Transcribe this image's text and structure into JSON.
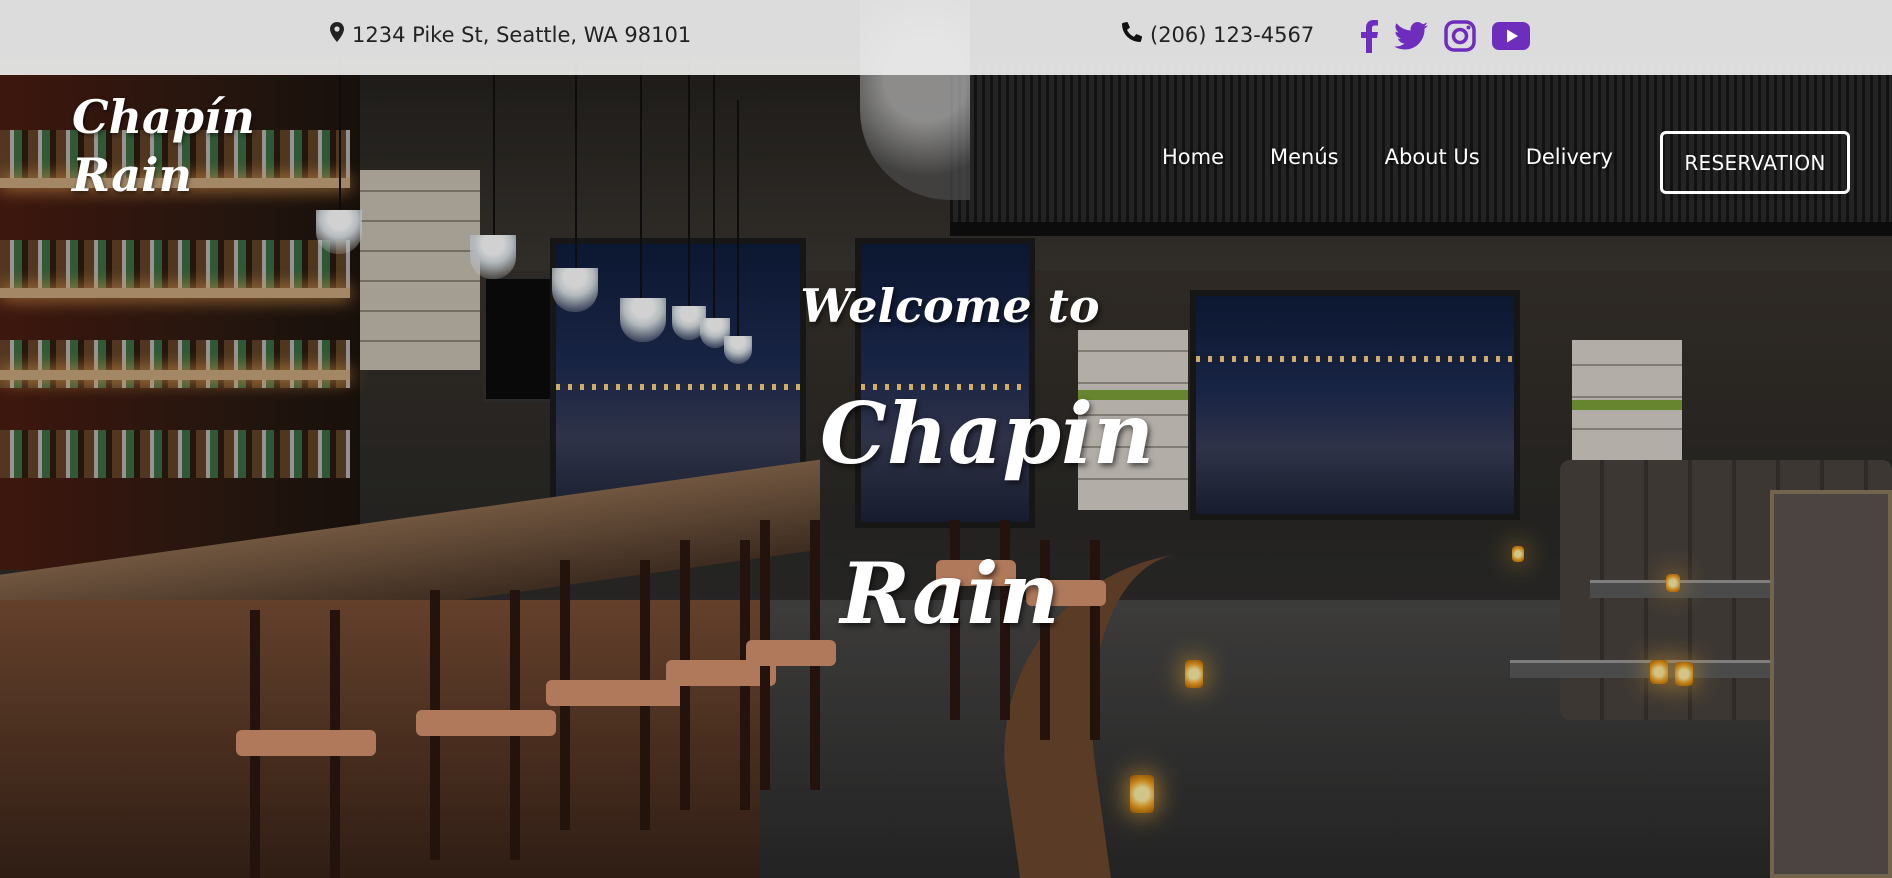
{
  "topbar": {
    "address": "1234 Pike St, Seattle, WA 98101",
    "address_icon": "map-marker-icon",
    "phone": "(206) 123-4567",
    "phone_icon": "phone-icon",
    "social": [
      {
        "name": "facebook-icon",
        "color": "#6f2dbd"
      },
      {
        "name": "twitter-icon",
        "color": "#6f2dbd"
      },
      {
        "name": "instagram-icon",
        "color": "#6f2dbd"
      },
      {
        "name": "youtube-icon",
        "color": "#6f2dbd"
      }
    ]
  },
  "logo": {
    "text": "Chapín Rain"
  },
  "nav": {
    "items": [
      {
        "label": "Home"
      },
      {
        "label": "Menús"
      },
      {
        "label": "About Us"
      },
      {
        "label": "Delivery"
      }
    ],
    "reservation_label": "RESERVATION"
  },
  "hero": {
    "welcome": "Welcome to",
    "name": "Chapin Rain"
  },
  "colors": {
    "topbar_bg": "#ececec",
    "social_accent": "#6f2dbd",
    "hero_text": "#ffffff"
  }
}
